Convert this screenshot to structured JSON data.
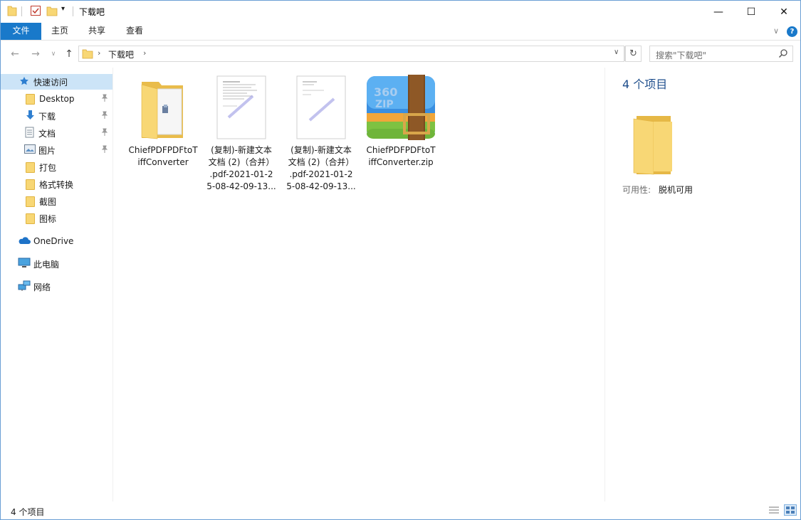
{
  "window": {
    "title": "下载吧",
    "minimize_glyph": "—",
    "maximize_glyph": "☐",
    "close_glyph": "✕"
  },
  "ribbon": {
    "tabs": [
      {
        "label": "文件",
        "active": true
      },
      {
        "label": "主页"
      },
      {
        "label": "共享"
      },
      {
        "label": "查看"
      }
    ]
  },
  "address": {
    "crumb": "下载吧",
    "search_placeholder": "搜索\"下载吧\""
  },
  "sidebar": {
    "items": [
      {
        "label": "快速访问",
        "icon": "star-icon"
      },
      {
        "label": "Desktop",
        "icon": "folder-icon",
        "pinned": true
      },
      {
        "label": "下载",
        "icon": "download-arrow-icon",
        "pinned": true
      },
      {
        "label": "文档",
        "icon": "document-icon",
        "pinned": true
      },
      {
        "label": "图片",
        "icon": "picture-icon",
        "pinned": true
      },
      {
        "label": "打包",
        "icon": "folder-icon"
      },
      {
        "label": "格式转换",
        "icon": "folder-icon"
      },
      {
        "label": "截图",
        "icon": "folder-icon"
      },
      {
        "label": "图标",
        "icon": "folder-icon"
      },
      {
        "label": "OneDrive",
        "icon": "cloud-icon"
      },
      {
        "label": "此电脑",
        "icon": "computer-icon"
      },
      {
        "label": "网络",
        "icon": "network-icon"
      }
    ]
  },
  "files": [
    {
      "name_lines": [
        "ChiefPDFPDFtoT",
        "iffConverter"
      ],
      "icon": "folder-icon"
    },
    {
      "name_lines": [
        "(复制)-新建文本",
        "文档 (2)（合并）",
        ".pdf-2021-01-2",
        "5-08-42-09-13..."
      ],
      "icon": "pdf-document-icon"
    },
    {
      "name_lines": [
        "(复制)-新建文本",
        "文档 (2)（合并）",
        ".pdf-2021-01-2",
        "5-08-42-09-13..."
      ],
      "icon": "pdf-document-icon"
    },
    {
      "name_lines": [
        "ChiefPDFPDFtoT",
        "iffConverter.zip"
      ],
      "icon": "zip-archive-icon"
    }
  ],
  "details": {
    "count": "4 个项目",
    "availability_label": "可用性:",
    "availability_value": "脱机可用"
  },
  "status": {
    "count": "4 个项目"
  },
  "colors": {
    "accent": "#1979ca",
    "folder": "#f8d775",
    "selection": "#cce4f7"
  }
}
